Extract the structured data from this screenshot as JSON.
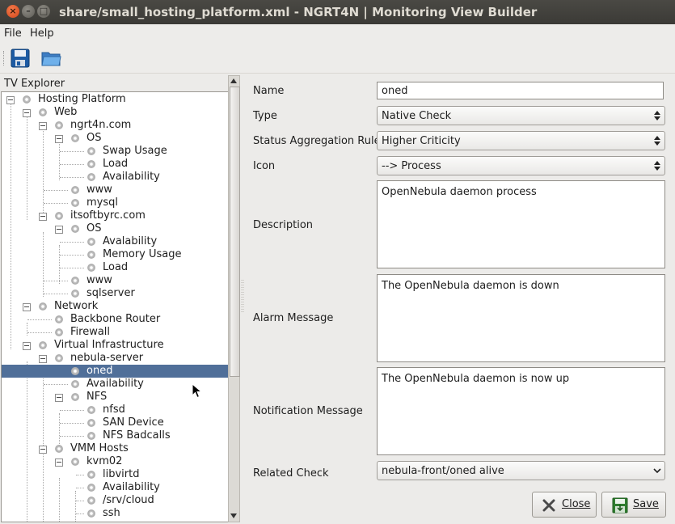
{
  "window": {
    "title": "share/small_hosting_platform.xml - NGRT4N | Monitoring View Builder",
    "buttons": {
      "close": "×",
      "minimize": "–",
      "maximize": "□"
    }
  },
  "menu": [
    "File",
    "Help"
  ],
  "toolbar": {
    "icons": [
      "save-icon",
      "open-folder-icon"
    ]
  },
  "explorer": {
    "header": "TV Explorer",
    "tree": [
      "Hosting Platform",
      "Web",
      "ngrt4n.com",
      "OS",
      "Swap Usage",
      "Load",
      "Availability",
      "www",
      "mysql",
      "itsoftbyrc.com",
      "OS",
      "Avalability",
      "Memory Usage",
      "Load",
      "www",
      "sqlserver",
      "Network",
      "Backbone Router",
      "Firewall",
      "Virtual Infrastructure",
      "nebula-server",
      "oned",
      "Availability",
      "NFS",
      "nfsd",
      "SAN Device",
      "NFS Badcalls",
      "VMM Hosts",
      "kvm02",
      "libvirtd",
      "Availability",
      "/srv/cloud",
      "ssh"
    ],
    "selected": "oned"
  },
  "form": {
    "name_label": "Name",
    "name_value": "oned",
    "type_label": "Type",
    "type_value": "Native Check",
    "rule_label": "Status Aggregation Rule",
    "rule_value": "Higher Criticity",
    "icon_label": "Icon",
    "icon_value": "--> Process",
    "description_label": "Description",
    "description_value": "OpenNebula daemon process",
    "alarm_label": "Alarm Message",
    "alarm_value": "The OpenNebula daemon is down",
    "notification_label": "Notification Message",
    "notification_value": "The OpenNebula daemon is now up",
    "related_label": "Related Check",
    "related_value": "nebula-front/oned alive"
  },
  "buttons": {
    "close": "Close",
    "save": "Save"
  },
  "colors": {
    "selection": "#506f99",
    "titlebar": "#3c3b37",
    "close_button": "#e2561f"
  }
}
